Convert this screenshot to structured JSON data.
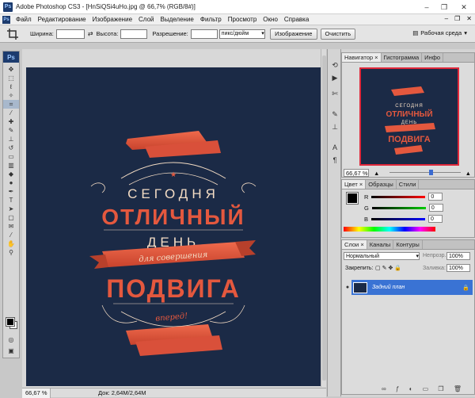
{
  "window": {
    "title": "Adobe Photoshop CS3 - [HnSiQSi4uHo.jpg @ 66,7% (RGB/8#)]",
    "controls": [
      "–",
      "❐",
      "✕"
    ]
  },
  "menubar": {
    "app_badge": "Ps",
    "items": [
      "Файл",
      "Редактирование",
      "Изображение",
      "Слой",
      "Выделение",
      "Фильтр",
      "Просмотр",
      "Окно",
      "Справка"
    ]
  },
  "options_bar": {
    "width_label": "Ширина:",
    "height_label": "Высота:",
    "resolution_label": "Разрешение:",
    "units_value": "пикс/дюйм",
    "image_button": "Изображение",
    "clear_button": "Очистить",
    "workspace_label": "Рабочая среда"
  },
  "toolbox": {
    "badge": "Ps",
    "icons": [
      "move-icon",
      "marquee-icon",
      "lasso-icon",
      "magic-wand-icon",
      "crop-icon",
      "eyedropper-icon",
      "healing-brush-icon",
      "brush-icon",
      "clone-stamp-icon",
      "history-brush-icon",
      "eraser-icon",
      "gradient-icon",
      "blur-icon",
      "dodge-icon",
      "pen-icon",
      "type-icon",
      "path-selection-icon",
      "shape-icon",
      "notes-icon",
      "eyedropper2-icon",
      "hand-icon",
      "zoom-icon"
    ]
  },
  "artwork": {
    "line1": "СЕГОДНЯ",
    "line2": "ОТЛИЧНЫЙ",
    "line3": "ДЕНЬ",
    "ribbon_text": "для совершения",
    "line4": "ПОДВИГА",
    "line5": "вперед!",
    "colors": {
      "background": "#1b2a46",
      "accent": "#e4583e",
      "cream": "#f3dcc4"
    }
  },
  "status_bar": {
    "zoom": "66,67 %",
    "doc_info": "Док: 2,64M/2,64M"
  },
  "navigator_panel": {
    "tabs": [
      "Навигатор ×",
      "Гистограмма",
      "Инфо"
    ],
    "zoom": "66,67 %"
  },
  "color_panel": {
    "tabs": [
      "Цвет ×",
      "Образцы",
      "Стили"
    ],
    "channels": [
      {
        "label": "R",
        "value": "0"
      },
      {
        "label": "G",
        "value": "0"
      },
      {
        "label": "B",
        "value": "0"
      }
    ]
  },
  "layers_panel": {
    "tabs": [
      "Слои ×",
      "Каналы",
      "Контуры"
    ],
    "blend_mode": "Нормальный",
    "opacity_label": "Непрозр.:",
    "opacity_value": "100%",
    "lock_label": "Закрепить:",
    "fill_label": "Заливка:",
    "fill_value": "100%",
    "layer_name": "Задний план"
  }
}
